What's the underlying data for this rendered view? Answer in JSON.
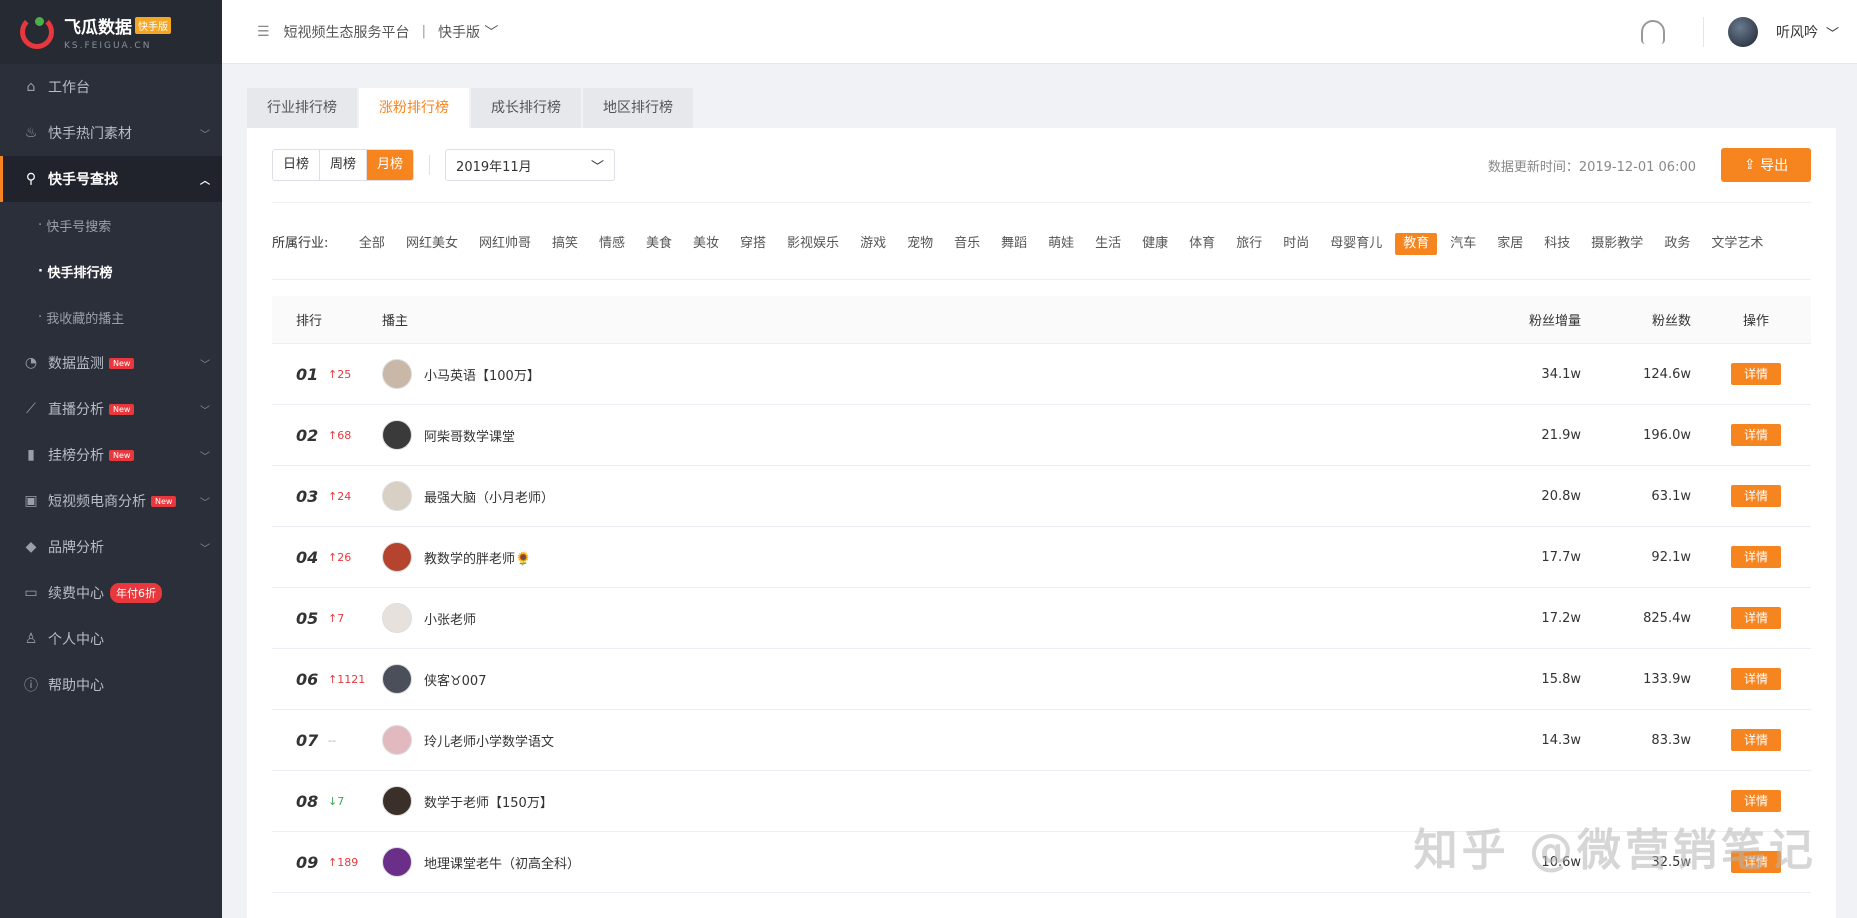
{
  "brand": {
    "name": "飞瓜数据",
    "badge": "快手版",
    "domain": "KS.FEIGUA.CN"
  },
  "sidebar": {
    "items": [
      {
        "label": "工作台",
        "icon": "home-icon"
      },
      {
        "label": "快手热门素材",
        "icon": "fire-icon"
      },
      {
        "label": "快手号查找",
        "icon": "search-icon"
      },
      {
        "label": "快手号搜索"
      },
      {
        "label": "快手排行榜"
      },
      {
        "label": "我收藏的播主"
      },
      {
        "label": "数据监测",
        "icon": "monitor-icon",
        "tag": "New"
      },
      {
        "label": "直播分析",
        "icon": "trend-icon",
        "tag": "New"
      },
      {
        "label": "挂榜分析",
        "icon": "bar-chart-icon",
        "tag": "New"
      },
      {
        "label": "短视频电商分析",
        "icon": "shop-bag-icon",
        "tag": "New"
      },
      {
        "label": "品牌分析",
        "icon": "diamond-icon"
      },
      {
        "label": "续费中心",
        "icon": "card-icon",
        "tag": "年付6折"
      },
      {
        "label": "个人中心",
        "icon": "user-icon"
      },
      {
        "label": "帮助中心",
        "icon": "help-icon"
      }
    ]
  },
  "topbar": {
    "crumb": "短视频生态服务平台",
    "separator": "|",
    "version": "快手版",
    "username": "听风吟"
  },
  "tabs": [
    "行业排行榜",
    "涨粉排行榜",
    "成长排行榜",
    "地区排行榜"
  ],
  "toolbar": {
    "periods": [
      "日榜",
      "周榜",
      "月榜"
    ],
    "date": "2019年11月",
    "update": "数据更新时间：2019-12-01 06:00",
    "export": "导出"
  },
  "industry": {
    "label": "所属行业:",
    "items": [
      "全部",
      "网红美女",
      "网红帅哥",
      "搞笑",
      "情感",
      "美食",
      "美妆",
      "穿搭",
      "影视娱乐",
      "游戏",
      "宠物",
      "音乐",
      "舞蹈",
      "萌娃",
      "生活",
      "健康",
      "体育",
      "旅行",
      "时尚",
      "母婴育儿",
      "教育",
      "汽车",
      "家居",
      "科技",
      "摄影教学",
      "政务",
      "文学艺术"
    ],
    "active": "教育"
  },
  "table": {
    "headers": {
      "rank": "排行",
      "anchor": "播主",
      "increase": "粉丝增量",
      "fans": "粉丝数",
      "op": "操作"
    },
    "detail_label": "详情",
    "rows": [
      {
        "rank": "01",
        "change": "↑25",
        "dir": "up",
        "name": "小马英语【100万】",
        "increase": "34.1w",
        "fans": "124.6w"
      },
      {
        "rank": "02",
        "change": "↑68",
        "dir": "up",
        "name": "阿柴哥数学课堂",
        "increase": "21.9w",
        "fans": "196.0w"
      },
      {
        "rank": "03",
        "change": "↑24",
        "dir": "up",
        "name": "最强大脑（小月老师）",
        "increase": "20.8w",
        "fans": "63.1w"
      },
      {
        "rank": "04",
        "change": "↑26",
        "dir": "up",
        "name": "教数学的胖老师🌻",
        "increase": "17.7w",
        "fans": "92.1w"
      },
      {
        "rank": "05",
        "change": "↑7",
        "dir": "up",
        "name": "小张老师",
        "increase": "17.2w",
        "fans": "825.4w"
      },
      {
        "rank": "06",
        "change": "↑1121",
        "dir": "up",
        "name": "侠客♉007",
        "increase": "15.8w",
        "fans": "133.9w"
      },
      {
        "rank": "07",
        "change": "--",
        "dir": "flat",
        "name": "玲儿老师小学数学语文",
        "increase": "14.3w",
        "fans": "83.3w"
      },
      {
        "rank": "08",
        "change": "↓7",
        "dir": "down",
        "name": "数学于老师【150万】",
        "increase": "",
        "fans": ""
      },
      {
        "rank": "09",
        "change": "↑189",
        "dir": "up",
        "name": "地理课堂老牛（初高全科）",
        "increase": "10.6w",
        "fans": "32.5w"
      }
    ]
  },
  "watermark": "知乎 @微营销笔记",
  "colors": {
    "accent": "#f7851f",
    "sidebar_bg": "#2b2f3a",
    "up": "#e8383d",
    "down": "#3aa757"
  }
}
